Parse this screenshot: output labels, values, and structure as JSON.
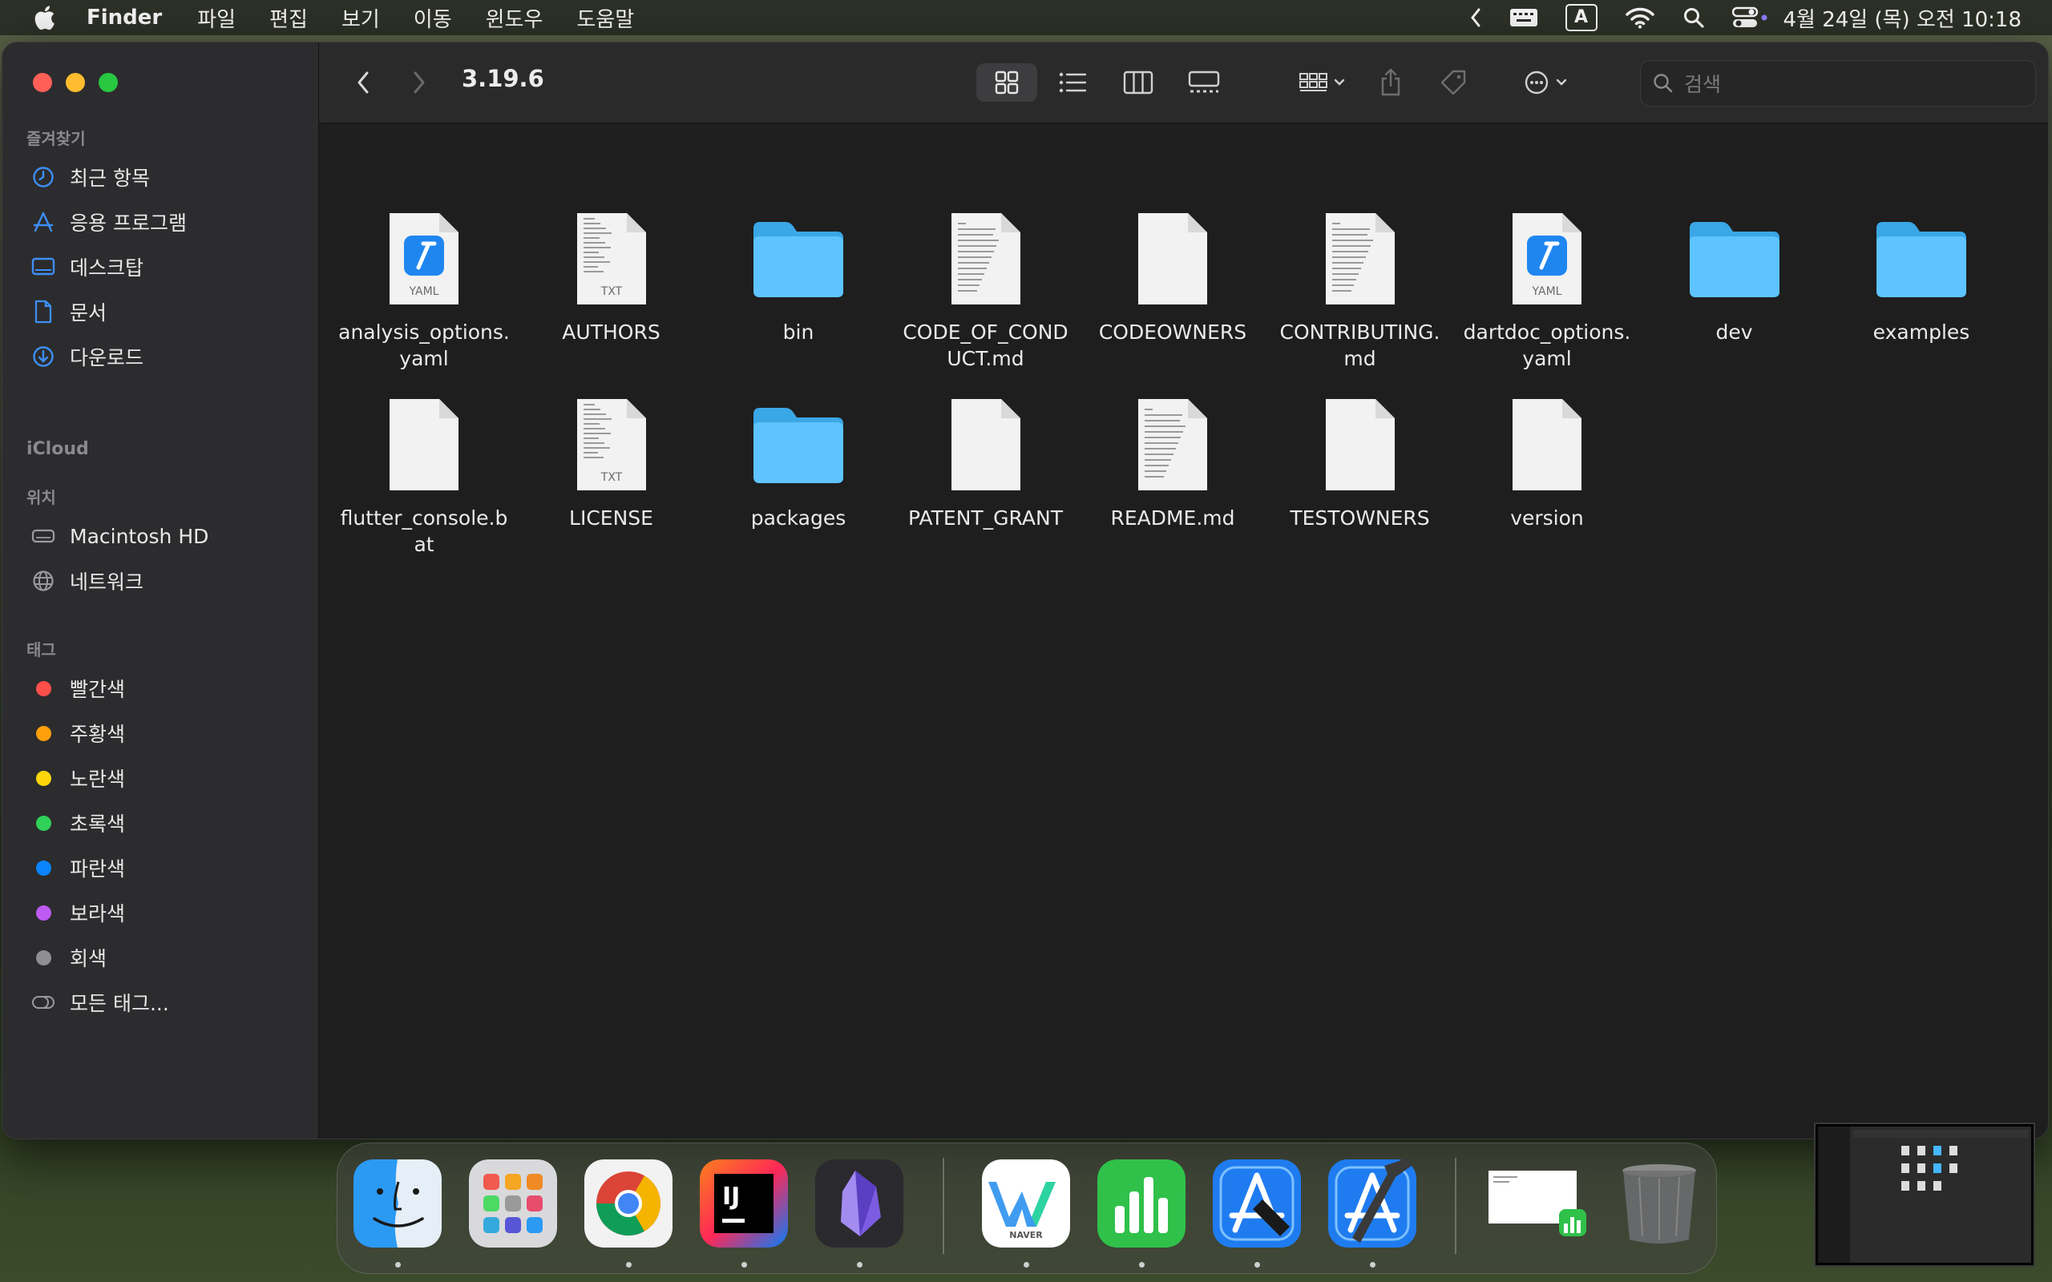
{
  "menubar": {
    "app": "Finder",
    "menus": [
      "파일",
      "편집",
      "보기",
      "이동",
      "윈도우",
      "도움말"
    ],
    "clock": "4월 24일 (목) 오전 10:18",
    "input_source": "A"
  },
  "sidebar": {
    "favorites_header": "즐겨찾기",
    "favorites": [
      {
        "label": "최근 항목",
        "icon": "clock-icon"
      },
      {
        "label": "응용 프로그램",
        "icon": "applications-icon"
      },
      {
        "label": "데스크탑",
        "icon": "desktop-icon"
      },
      {
        "label": "문서",
        "icon": "document-icon"
      },
      {
        "label": "다운로드",
        "icon": "download-icon"
      }
    ],
    "icloud_header": "iCloud",
    "locations_header": "위치",
    "locations": [
      {
        "label": "Macintosh HD",
        "icon": "disk-icon"
      },
      {
        "label": "네트워크",
        "icon": "globe-icon"
      }
    ],
    "tags_header": "태그",
    "tags": [
      {
        "label": "빨간색",
        "color": "#ff4f4b"
      },
      {
        "label": "주황색",
        "color": "#ff9f0a"
      },
      {
        "label": "노란색",
        "color": "#ffd60a"
      },
      {
        "label": "초록색",
        "color": "#30d158"
      },
      {
        "label": "파란색",
        "color": "#0a84ff"
      },
      {
        "label": "보라색",
        "color": "#bf5af2"
      },
      {
        "label": "회색",
        "color": "#8e8e93"
      }
    ],
    "all_tags": "모든 태그..."
  },
  "toolbar": {
    "title": "3.19.6",
    "search_placeholder": "검색",
    "active_view": "icon-view"
  },
  "files": [
    {
      "name": "analysis_options.yaml",
      "kind": "yaml",
      "label": "YAML"
    },
    {
      "name": "AUTHORS",
      "kind": "txt",
      "label": "TXT"
    },
    {
      "name": "bin",
      "kind": "folder"
    },
    {
      "name": "CODE_OF_CONDUCT.md",
      "kind": "textdoc"
    },
    {
      "name": "CODEOWNERS",
      "kind": "blank"
    },
    {
      "name": "CONTRIBUTING.md",
      "kind": "textdoc"
    },
    {
      "name": "dartdoc_options.yaml",
      "kind": "yaml",
      "label": "YAML"
    },
    {
      "name": "dev",
      "kind": "folder"
    },
    {
      "name": "examples",
      "kind": "folder"
    },
    {
      "name": "flutter_console.bat",
      "kind": "blank"
    },
    {
      "name": "LICENSE",
      "kind": "txt",
      "label": "TXT"
    },
    {
      "name": "packages",
      "kind": "folder"
    },
    {
      "name": "PATENT_GRANT",
      "kind": "blank"
    },
    {
      "name": "README.md",
      "kind": "textdoc"
    },
    {
      "name": "TESTOWNERS",
      "kind": "blank"
    },
    {
      "name": "version",
      "kind": "blank"
    }
  ],
  "dock": [
    {
      "name": "finder",
      "running": true
    },
    {
      "name": "launchpad",
      "running": false
    },
    {
      "name": "chrome",
      "running": true
    },
    {
      "name": "intellij",
      "running": true
    },
    {
      "name": "obsidian",
      "running": true
    },
    {
      "name": "naver-whale",
      "running": true,
      "label": "NAVER"
    },
    {
      "name": "numbers",
      "running": true
    },
    {
      "name": "xcode-instruments",
      "running": true
    },
    {
      "name": "xcode",
      "running": true
    },
    {
      "name": "numbers-document",
      "running": false
    },
    {
      "name": "trash",
      "running": false
    }
  ]
}
